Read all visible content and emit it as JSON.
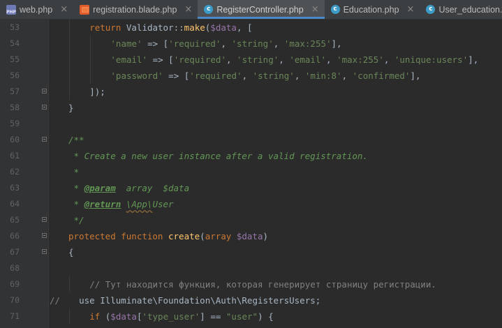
{
  "tabs": [
    {
      "label": "web.php",
      "icon": "php-file-icon",
      "active": false
    },
    {
      "label": "registration.blade.php",
      "icon": "blade-file-icon",
      "active": false
    },
    {
      "label": "RegisterController.php",
      "icon": "class-file-icon",
      "active": true
    },
    {
      "label": "Education.php",
      "icon": "class-file-icon",
      "active": false
    },
    {
      "label": "User_education.php",
      "icon": "class-file-icon",
      "active": false
    }
  ],
  "class_icon_letter": "c",
  "close_glyph": "×",
  "colors": {
    "keyword": "#cc7832",
    "string": "#6a8759",
    "variable": "#9876aa",
    "function": "#ffc66d",
    "doc_comment": "#629755",
    "comment": "#808080",
    "text": "#a9b7c6",
    "active_tab_underline": "#4a88c7"
  },
  "lines": [
    {
      "n": "53",
      "indent": 4,
      "tokens": [
        [
          "kw",
          "return "
        ],
        [
          "plain",
          "Validator::"
        ],
        [
          "fn",
          "make"
        ],
        [
          "plain",
          "("
        ],
        [
          "var",
          "$data"
        ],
        [
          "plain",
          ", ["
        ]
      ]
    },
    {
      "n": "54",
      "indent": 8,
      "tokens": [
        [
          "str",
          "'name'"
        ],
        [
          "plain",
          " => ["
        ],
        [
          "str",
          "'required'"
        ],
        [
          "plain",
          ", "
        ],
        [
          "str",
          "'string'"
        ],
        [
          "plain",
          ", "
        ],
        [
          "str",
          "'max:255'"
        ],
        [
          "plain",
          "],"
        ]
      ]
    },
    {
      "n": "55",
      "indent": 8,
      "tokens": [
        [
          "str",
          "'email'"
        ],
        [
          "plain",
          " => ["
        ],
        [
          "str",
          "'required'"
        ],
        [
          "plain",
          ", "
        ],
        [
          "str",
          "'string'"
        ],
        [
          "plain",
          ", "
        ],
        [
          "str",
          "'email'"
        ],
        [
          "plain",
          ", "
        ],
        [
          "str",
          "'max:255'"
        ],
        [
          "plain",
          ", "
        ],
        [
          "str",
          "'unique:users'"
        ],
        [
          "plain",
          "],"
        ]
      ]
    },
    {
      "n": "56",
      "indent": 8,
      "tokens": [
        [
          "str",
          "'password'"
        ],
        [
          "plain",
          " => ["
        ],
        [
          "str",
          "'required'"
        ],
        [
          "plain",
          ", "
        ],
        [
          "str",
          "'string'"
        ],
        [
          "plain",
          ", "
        ],
        [
          "str",
          "'min:8'"
        ],
        [
          "plain",
          ", "
        ],
        [
          "str",
          "'confirmed'"
        ],
        [
          "plain",
          "],"
        ]
      ]
    },
    {
      "n": "57",
      "indent": 4,
      "tokens": [
        [
          "plain",
          "]);"
        ]
      ]
    },
    {
      "n": "58",
      "indent": 0,
      "tokens": [
        [
          "plain",
          "}"
        ]
      ]
    },
    {
      "n": "59",
      "indent": 0,
      "tokens": []
    },
    {
      "n": "60",
      "indent": 0,
      "tokens": [
        [
          "doc",
          "/**"
        ]
      ]
    },
    {
      "n": "61",
      "indent": 0,
      "tokens": [
        [
          "doc",
          " * Create a new user instance after a valid registration."
        ]
      ]
    },
    {
      "n": "62",
      "indent": 0,
      "tokens": [
        [
          "doc",
          " *"
        ]
      ]
    },
    {
      "n": "63",
      "indent": 0,
      "tokens": [
        [
          "doc",
          " * "
        ],
        [
          "tag",
          "@param"
        ],
        [
          "doc",
          "  array  $data"
        ]
      ]
    },
    {
      "n": "64",
      "indent": 0,
      "tokens": [
        [
          "doc",
          " * "
        ],
        [
          "tag",
          "@return"
        ],
        [
          "doc",
          " "
        ],
        [
          "docfq",
          "\\App\\"
        ],
        [
          "doc",
          "User"
        ]
      ]
    },
    {
      "n": "65",
      "indent": 0,
      "tokens": [
        [
          "doc",
          " */"
        ]
      ]
    },
    {
      "n": "66",
      "indent": 0,
      "tokens": [
        [
          "kw",
          "protected function "
        ],
        [
          "fn",
          "create"
        ],
        [
          "plain",
          "("
        ],
        [
          "kw",
          "array "
        ],
        [
          "var",
          "$data"
        ],
        [
          "plain",
          ")"
        ]
      ]
    },
    {
      "n": "67",
      "indent": 0,
      "tokens": [
        [
          "plain",
          "{"
        ]
      ]
    },
    {
      "n": "68",
      "indent": 0,
      "tokens": []
    },
    {
      "n": "69",
      "indent": 4,
      "tokens": [
        [
          "cmt",
          "// Тут находится функция, которая генерирует страницу регистрации."
        ]
      ]
    },
    {
      "n": "70",
      "indent": 2,
      "prefix": "//",
      "tokens": [
        [
          "plain",
          "use Illuminate\\Foundation\\Auth\\RegistersUsers;"
        ]
      ]
    },
    {
      "n": "71",
      "indent": 4,
      "tokens": [
        [
          "kw",
          "if "
        ],
        [
          "plain",
          "("
        ],
        [
          "var",
          "$data"
        ],
        [
          "plain",
          "["
        ],
        [
          "str",
          "'type_user'"
        ],
        [
          "plain",
          "] == "
        ],
        [
          "str",
          "\"user\""
        ],
        [
          "plain",
          ") {"
        ]
      ]
    }
  ]
}
